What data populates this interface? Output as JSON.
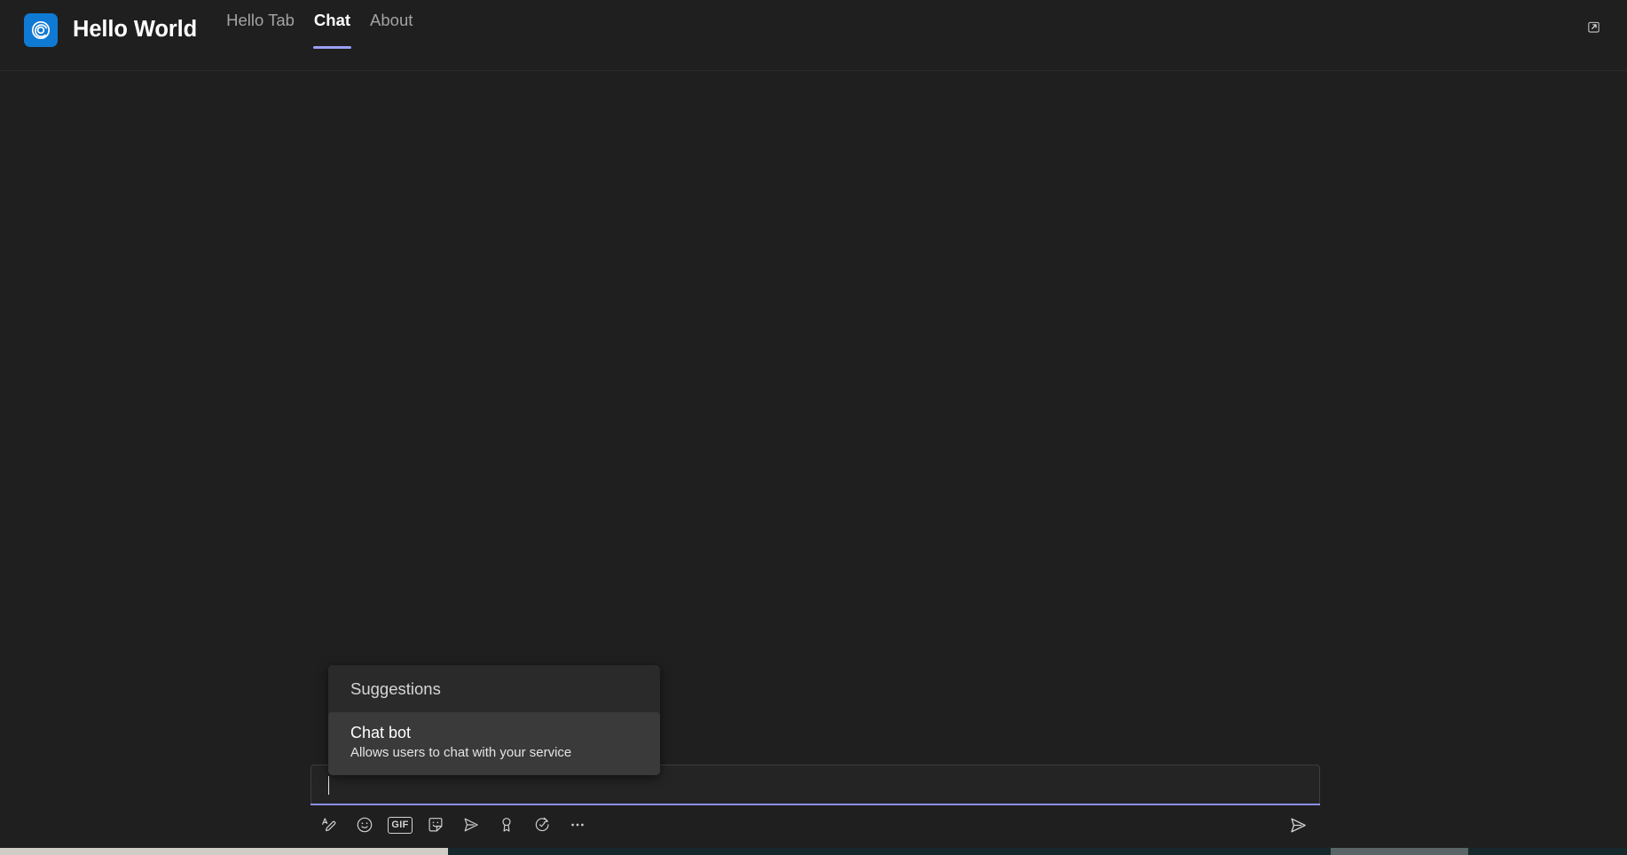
{
  "header": {
    "logo_icon": "spiral-logo-icon",
    "logo_bg": "#0f7ad4",
    "title": "Hello World",
    "tabs": [
      {
        "label": "Hello Tab",
        "active": false
      },
      {
        "label": "Chat",
        "active": true
      },
      {
        "label": "About",
        "active": false
      }
    ],
    "active_tab_accent": "#9aa0f5",
    "popout_icon": "open-in-new-window-icon"
  },
  "suggestions": {
    "header_label": "Suggestions",
    "items": [
      {
        "title": "Chat bot",
        "description": "Allows users to chat with your service",
        "highlighted": true
      }
    ]
  },
  "compose": {
    "value": "",
    "placeholder": "",
    "focus_accent": "#8b90e8",
    "toolbar": [
      {
        "name": "format-text-icon",
        "label": "Format"
      },
      {
        "name": "emoji-icon",
        "label": "Emoji"
      },
      {
        "name": "gif-icon",
        "label": "GIF"
      },
      {
        "name": "sticker-icon",
        "label": "Sticker"
      },
      {
        "name": "send-options-icon",
        "label": "Delivery options"
      },
      {
        "name": "praise-icon",
        "label": "Praise"
      },
      {
        "name": "schedule-icon",
        "label": "Schedule send"
      },
      {
        "name": "more-options-icon",
        "label": "More options"
      }
    ],
    "send_button": {
      "name": "send-icon",
      "label": "Send"
    }
  },
  "scrollbar": {
    "orientation": "horizontal",
    "track_color": "#17282c",
    "thumb_color": "#cfcdc6"
  },
  "colors": {
    "app_bg": "#1f1f1f",
    "header_bg": "#201f1f",
    "popup_bg": "#2b2a2a",
    "popup_item_bg": "#3b3a3a",
    "compose_bg": "#252424",
    "accent": "#8b90e8"
  }
}
